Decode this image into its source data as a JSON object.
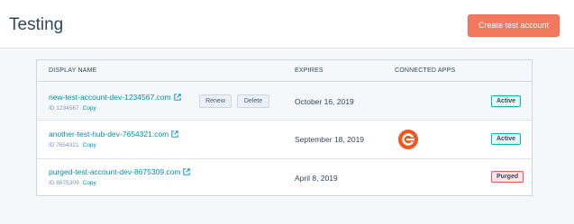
{
  "page": {
    "title": "Testing",
    "create_button_label": "Create test account"
  },
  "table": {
    "headers": {
      "display_name": "DISPLAY NAME",
      "expires": "EXPIRES",
      "connected_apps": "CONNECTED APPS"
    },
    "rows": [
      {
        "name": "new-test-account-dev-1234567.com",
        "id_text": "ID 1234567",
        "copy_label": "Copy",
        "expires": "October 16, 2019",
        "renew_label": "Renew",
        "delete_label": "Delete",
        "status": "Active",
        "has_app": false
      },
      {
        "name": "another-test-hub-dev-7654321.com",
        "id_text": "ID 7654321",
        "copy_label": "Copy",
        "expires": "September 18, 2019",
        "status": "Active",
        "has_app": true,
        "app_icon": "connected-app-logo-icon"
      },
      {
        "name": "purged-test-account-dev-8675309.com",
        "id_text": "ID 8675309",
        "copy_label": "Copy",
        "expires": "April 8, 2019",
        "status": "Purged",
        "has_app": false
      }
    ]
  },
  "colors": {
    "accent": "#f2795f",
    "link": "#0091ae",
    "active_border": "#00bda5",
    "purged_border": "#f2545b"
  }
}
